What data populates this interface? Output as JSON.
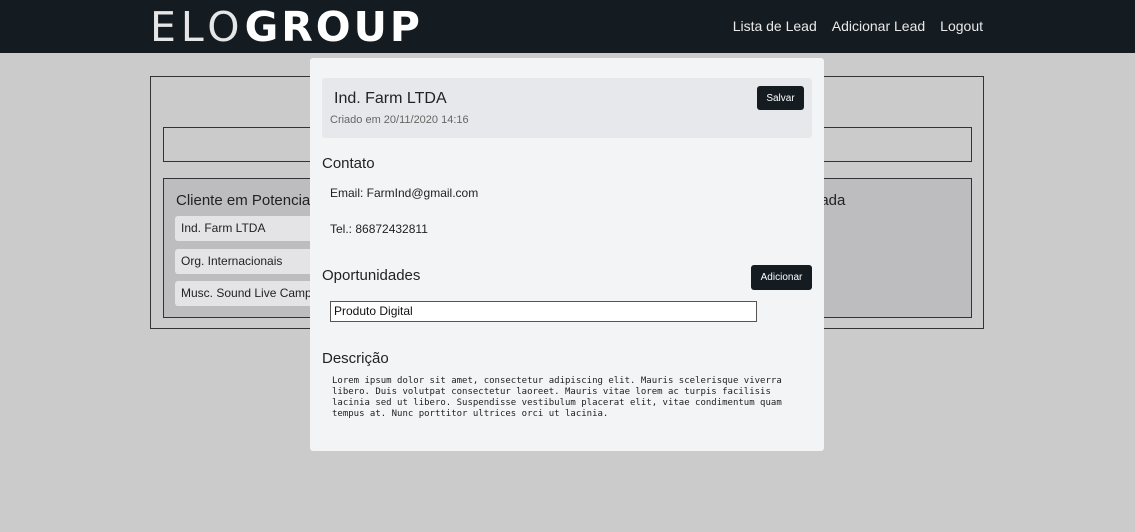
{
  "header": {
    "logo_thin": "ELO",
    "logo_bold": "GROUP",
    "nav": [
      "Lista de Lead",
      "Adicionar Lead",
      "Logout"
    ]
  },
  "board": {
    "col_left_title": "Cliente em Potencial",
    "col_right_title": "dada",
    "leads": [
      "Ind. Farm LTDA",
      "Org. Internacionais",
      "Musc. Sound Live Camp"
    ]
  },
  "modal": {
    "lead_name": "Ind. Farm LTDA",
    "created": "Criado em 20/11/2020 14:16",
    "save_label": "Salvar",
    "contact_title": "Contato",
    "email": "Email: FarmInd@gmail.com",
    "phone": "Tel.: 86872432811",
    "opportunities_title": "Oportunidades",
    "add_label": "Adicionar",
    "opportunity_selected": "Produto Digital",
    "description_title": "Descrição",
    "description_text": "Lorem ipsum dolor sit amet, consectetur adipiscing elit. Mauris scelerisque viverra libero. Duis volutpat consectetur laoreet. Mauris vitae lorem ac turpis facilisis lacinia sed ut libero. Suspendisse vestibulum placerat elit, vitae condimentum quam tempus at. Nunc porttitor ultrices orci ut lacinia."
  },
  "colors": {
    "header_bg": "#141c22",
    "page_bg": "#cbcbcb",
    "modal_bg": "#f3f4f6",
    "button_bg": "#141c22"
  }
}
